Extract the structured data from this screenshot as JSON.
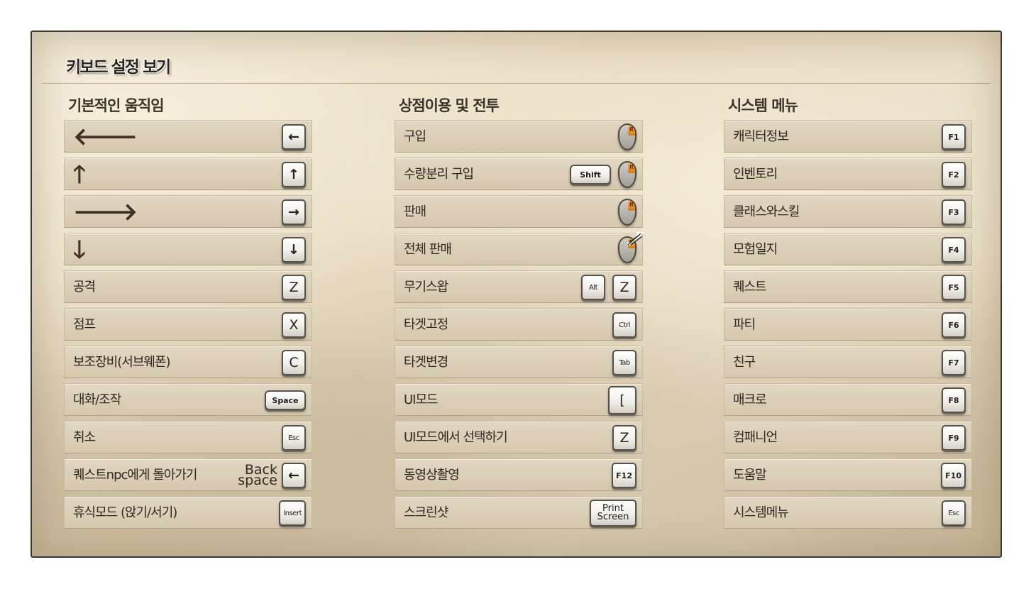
{
  "title": "키보드 설정 보기",
  "columns": [
    {
      "heading": "기본적인 움직임",
      "rows": [
        {
          "icon": "arrow-left-icon",
          "glyph": "🡐",
          "key": "←"
        },
        {
          "icon": "arrow-up-icon",
          "glyph": "🡑",
          "key": "↑"
        },
        {
          "icon": "arrow-right-icon",
          "glyph": "🡒",
          "key": "→"
        },
        {
          "icon": "arrow-down-icon",
          "glyph": "🡓",
          "key": "↓"
        },
        {
          "label": "공격",
          "key": "Z"
        },
        {
          "label": "점프",
          "key": "X"
        },
        {
          "label": "보조장비(서브웨폰)",
          "key": "C"
        },
        {
          "label": "대화/조작",
          "key": "Space"
        },
        {
          "label": "취소",
          "key": "Esc"
        },
        {
          "label": "퀘스트npc에게 돌아가기",
          "key_text": [
            "Back",
            "space"
          ],
          "key": "←"
        },
        {
          "label": "휴식모드 (앉기/서기)",
          "key": "Insert"
        }
      ]
    },
    {
      "heading": "상점이용 및 전투",
      "rows": [
        {
          "label": "구입",
          "mouse": "R"
        },
        {
          "label": "수량분리 구입",
          "key": "Shift",
          "mouse": "R"
        },
        {
          "label": "판매",
          "mouse": "R"
        },
        {
          "label": "전체 판매",
          "mouse": "R"
        },
        {
          "label": "무기스왑",
          "keys": [
            "Alt",
            "Z"
          ]
        },
        {
          "label": "타겟고정",
          "key": "Ctrl"
        },
        {
          "label": "타겟변경",
          "key": "Tab"
        },
        {
          "label": "UI모드",
          "key": "["
        },
        {
          "label": "UI모드에서 선택하기",
          "key": "Z"
        },
        {
          "label": "동영상촬영",
          "key": "F12"
        },
        {
          "label": "스크린샷",
          "key_lines": [
            "Print",
            "Screen"
          ]
        }
      ]
    },
    {
      "heading": "시스템 메뉴",
      "rows": [
        {
          "label": "캐릭터정보",
          "key": "F1"
        },
        {
          "label": "인벤토리",
          "key": "F2"
        },
        {
          "label": "클래스와스킬",
          "key": "F3"
        },
        {
          "label": "모험일지",
          "key": "F4"
        },
        {
          "label": "퀘스트",
          "key": "F5"
        },
        {
          "label": "파티",
          "key": "F6"
        },
        {
          "label": "친구",
          "key": "F7"
        },
        {
          "label": "매크로",
          "key": "F8"
        },
        {
          "label": "컴패니언",
          "key": "F9"
        },
        {
          "label": "도움말",
          "key": "F10"
        },
        {
          "label": "시스템메뉴",
          "key": "Esc"
        }
      ]
    }
  ],
  "colors": {
    "panel_border": "#3d3a34",
    "row_bg": "#d9ceb6",
    "text": "#2d2820",
    "mouse_button": "#f0a030"
  }
}
